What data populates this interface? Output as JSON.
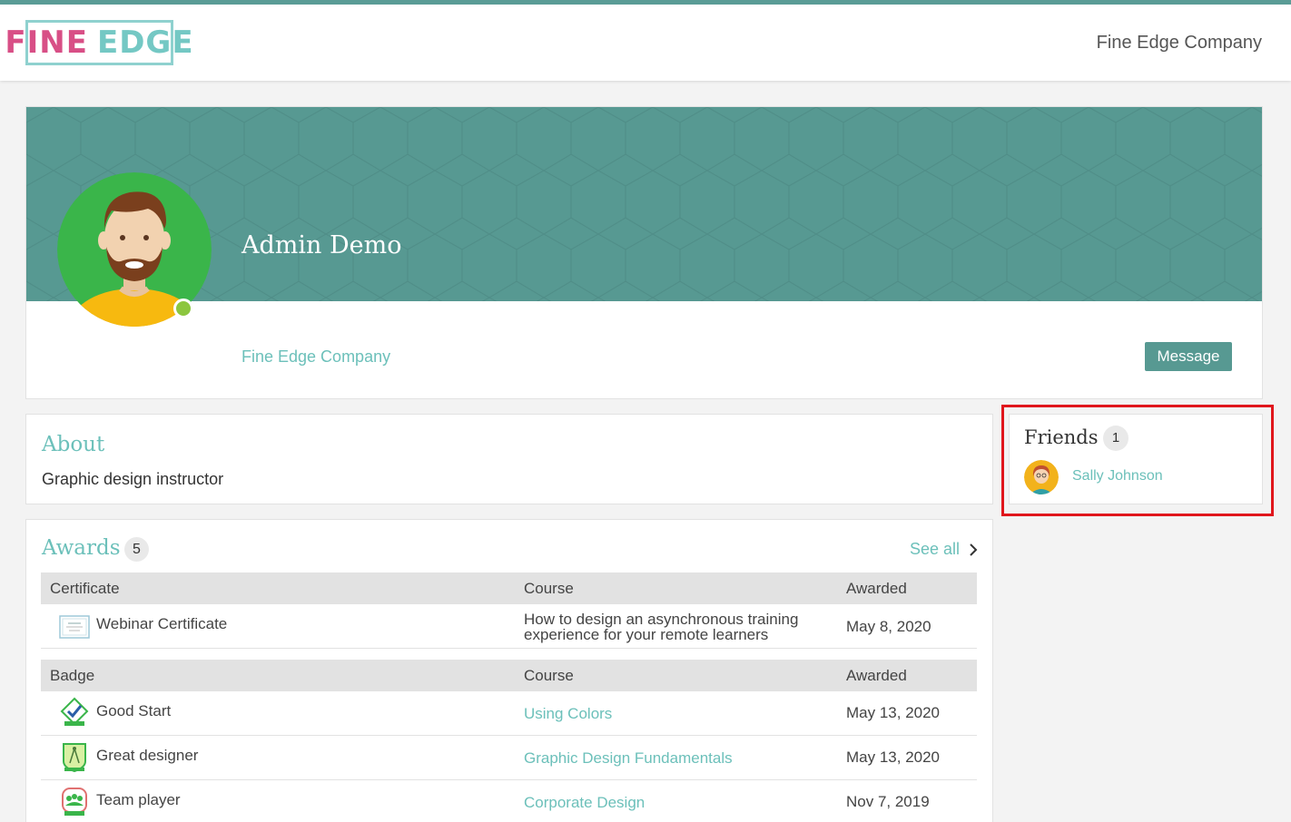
{
  "header": {
    "logo_left": "FINE",
    "logo_right": "EDGE",
    "company": "Fine Edge Company"
  },
  "profile": {
    "name": "Admin Demo",
    "company": "Fine Edge Company",
    "message_label": "Message",
    "status": "online"
  },
  "about": {
    "title": "About",
    "text": "Graphic design instructor"
  },
  "friends": {
    "title": "Friends",
    "count": "1",
    "items": [
      {
        "name": "Sally Johnson"
      }
    ]
  },
  "awards": {
    "title": "Awards",
    "count": "5",
    "see_all": "See all",
    "certificates": {
      "headers": [
        "Certificate",
        "Course",
        "Awarded"
      ],
      "rows": [
        {
          "name": "Webinar Certificate",
          "course": "How to design an asynchronous training experience for your remote learners",
          "date": "May 8, 2020",
          "icon": "certificate-icon"
        }
      ]
    },
    "badges": {
      "headers": [
        "Badge",
        "Course",
        "Awarded"
      ],
      "rows": [
        {
          "name": "Good Start",
          "course": "Using Colors",
          "date": "May 13, 2020",
          "icon": "checkmark-badge-icon"
        },
        {
          "name": "Great designer",
          "course": "Graphic Design Fundamentals",
          "date": "May 13, 2020",
          "icon": "compass-badge-icon"
        },
        {
          "name": "Team player",
          "course": "Corporate Design",
          "date": "Nov 7, 2019",
          "icon": "team-badge-icon"
        }
      ]
    }
  },
  "colors": {
    "teal": "#579992",
    "accent": "#6cc0ba",
    "logo_pink": "#d84f86",
    "online": "#8cc63f",
    "highlight": "#e0161c"
  }
}
